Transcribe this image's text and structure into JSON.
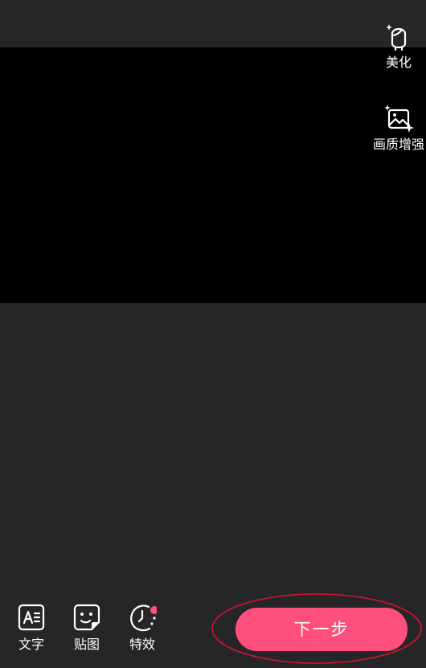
{
  "side_tools": {
    "beauty": {
      "label": "美化",
      "icon": "face-sparkle-icon"
    },
    "quality": {
      "label": "画质增强",
      "icon": "image-enhance-icon"
    }
  },
  "bottom_tools": {
    "text": {
      "label": "文字",
      "icon": "text-icon"
    },
    "sticker": {
      "label": "贴图",
      "icon": "sticker-icon"
    },
    "effect": {
      "label": "特效",
      "icon": "effect-clock-icon",
      "has_dot": true
    }
  },
  "next_button": {
    "label": "下一步"
  },
  "colors": {
    "background": "#262628",
    "preview": "#000000",
    "accent": "#fe4f7d",
    "annotation": "#d4132b"
  }
}
